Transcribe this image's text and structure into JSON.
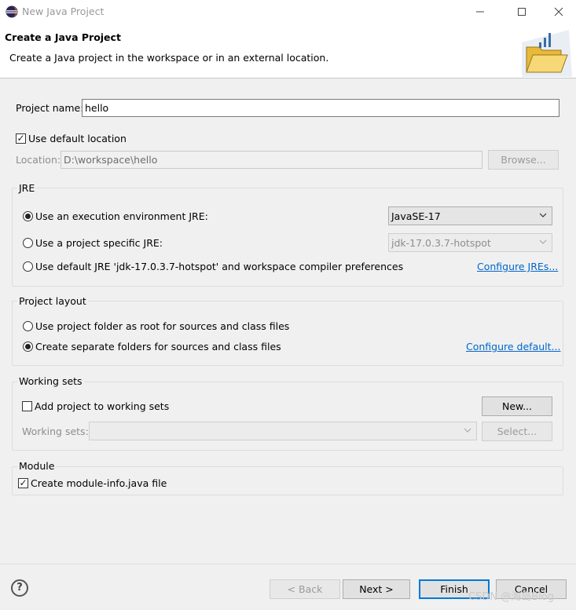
{
  "window": {
    "title": "New Java Project",
    "controls": [
      "minimize-icon",
      "maximize-icon",
      "close-icon"
    ]
  },
  "header": {
    "title": "Create a Java Project",
    "description": "Create a Java project in the workspace or in an external location.",
    "image": "folder-icon"
  },
  "project": {
    "name_label": "Project name:",
    "name_value": "hello",
    "use_default_location_label": "Use default location",
    "use_default_location_checked": true,
    "location_label": "Location:",
    "location_value": "D:\\workspace\\hello",
    "browse_label": "Browse..."
  },
  "jre": {
    "group_title": "JRE",
    "option_env_label": "Use an execution environment JRE:",
    "option_env_value": "JavaSE-17",
    "option_specific_label": "Use a project specific JRE:",
    "option_specific_value": "jdk-17.0.3.7-hotspot",
    "option_default_label": "Use default JRE 'jdk-17.0.3.7-hotspot' and workspace compiler preferences",
    "configure_link": "Configure JREs...",
    "selected": "env"
  },
  "layout": {
    "group_title": "Project layout",
    "option_root_label": "Use project folder as root for sources and class files",
    "option_separate_label": "Create separate folders for sources and class files",
    "configure_link": "Configure default...",
    "selected": "separate"
  },
  "working_sets": {
    "group_title": "Working sets",
    "add_label": "Add project to working sets",
    "add_checked": false,
    "new_button": "New...",
    "sets_label": "Working sets:",
    "sets_value": "",
    "select_button": "Select..."
  },
  "module": {
    "group_title": "Module",
    "create_label": "Create module-info.java file",
    "create_checked": true
  },
  "footer": {
    "help": "?",
    "back": "< Back",
    "next": "Next >",
    "finish": "Finish",
    "cancel": "Cancel"
  },
  "watermark": "CSDN @海岛Blog",
  "colors": {
    "link": "#0066cc",
    "default_button_border": "#0078d7",
    "background": "#f0f0f0"
  }
}
